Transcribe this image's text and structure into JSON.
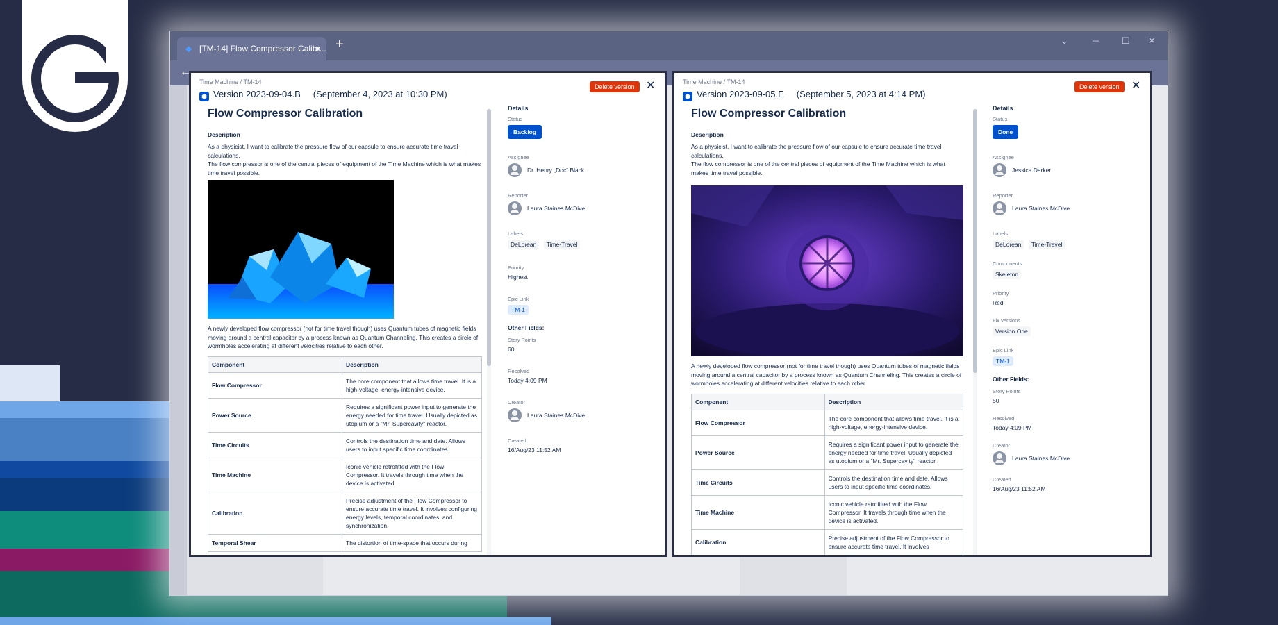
{
  "browser": {
    "tab_title": "[TM-14] Flow Compressor Calibr...",
    "tab_close": "×",
    "new_tab": "+",
    "win_min": "─",
    "win_max": "☐",
    "win_close": "✕",
    "back": "←"
  },
  "left": {
    "breadcrumb": "Time Machine  /  TM-14",
    "version": "Version 2023-09-04.B",
    "version_date": "(September 4, 2023 at 10:30 PM)",
    "delete_label": "Delete version",
    "close": "✕",
    "title": "Flow Compressor Calibration",
    "desc_heading": "Description",
    "desc_p1": "As a physicist, I want to calibrate the pressure flow of our capsule to ensure accurate time travel calculations.",
    "desc_p2": "The flow compressor is one of the central pieces of equipment of the Time Machine which is what makes time travel possible.",
    "desc_p3": "A newly developed flow compressor (not for time travel though) uses Quantum tubes of magnetic fields moving around a central capacitor by a process known as Quantum Channeling. This creates a circle of wormholes accelerating at different velocities relative to each other.",
    "table_head": [
      "Component",
      "Description"
    ],
    "rows": [
      [
        "Flow Compressor",
        "The core component that allows time travel. It is a high-voltage, energy-intensive device."
      ],
      [
        "Power Source",
        "Requires a significant power input to generate the energy needed for time travel. Usually depicted as utopium or a \"Mr. Supercavity\" reactor."
      ],
      [
        "Time Circuits",
        "Controls the destination time and date. Allows users to input specific time coordinates."
      ],
      [
        "Time Machine",
        "Iconic vehicle retrofitted with the Flow Compressor. It travels through time when the device is activated."
      ],
      [
        "Calibration",
        "Precise adjustment of the Flow Compressor to ensure accurate time travel. It involves configuring energy levels, temporal coordinates, and synchronization."
      ],
      [
        "Temporal Shear",
        "The distortion of time-space that occurs during"
      ]
    ],
    "details": {
      "heading": "Details",
      "status_label": "Status",
      "status": "Backlog",
      "assignee_label": "Assignee",
      "assignee": "Dr. Henry „Doc“ Black",
      "reporter_label": "Reporter",
      "reporter": "Laura Staines McDive",
      "labels_label": "Labels",
      "labels": [
        "DeLorean",
        "Time-Travel"
      ],
      "priority_label": "Priority",
      "priority": "Highest",
      "epic_label": "Epic Link",
      "epic": "TM-1",
      "other_heading": "Other Fields:",
      "story_points_label": "Story Points",
      "story_points": "60",
      "resolved_label": "Resolved",
      "resolved": "Today 4:09 PM",
      "creator_label": "Creator",
      "creator": "Laura Staines McDive",
      "created_label": "Created",
      "created": "16/Aug/23 11:52 AM"
    }
  },
  "right": {
    "breadcrumb": "Time Machine  /  TM-14",
    "version": "Version 2023-09-05.E",
    "version_date": "(September 5, 2023 at 4:14 PM)",
    "delete_label": "Delete version",
    "close": "✕",
    "title": "Flow Compressor Calibration",
    "desc_heading": "Description",
    "desc_p1": "As a physicist, I want to calibrate the pressure flow of our capsule to ensure accurate time travel calculations.",
    "desc_p2": "The flow compressor is one of the central pieces of equipment of the Time Machine which is what makes time travel possible.",
    "desc_p3": "A newly developed flow compressor (not for time travel though) uses Quantum tubes of magnetic fields moving around a central capacitor by a process known as Quantum Channeling. This creates a circle of wormholes accelerating at different velocities relative to each other.",
    "table_head": [
      "Component",
      "Description"
    ],
    "rows": [
      [
        "Flow Compressor",
        "The core component that allows time travel. It is a high-voltage, energy-intensive device."
      ],
      [
        "Power Source",
        "Requires a significant power input to generate the energy needed for time travel. Usually depicted as utopium or a \"Mr. Supercavity\" reactor."
      ],
      [
        "Time Circuits",
        "Controls the destination time and date. Allows users to input specific time coordinates."
      ],
      [
        "Time Machine",
        "Iconic vehicle retrofitted with the Flow Compressor. It travels through time when the device is activated."
      ],
      [
        "Calibration",
        "Precise adjustment of the Flow Compressor to ensure accurate time travel. It involves"
      ]
    ],
    "details": {
      "heading": "Details",
      "status_label": "Status",
      "status": "Done",
      "assignee_label": "Assignee",
      "assignee": "Jessica Darker",
      "reporter_label": "Reporter",
      "reporter": "Laura Staines McDive",
      "labels_label": "Labels",
      "labels": [
        "DeLorean",
        "Time-Travel"
      ],
      "components_label": "Components",
      "components": "Skeleton",
      "priority_label": "Priority",
      "priority": "Red",
      "fixver_label": "Fix versions",
      "fixver": "Version One",
      "epic_label": "Epic Link",
      "epic": "TM-1",
      "other_heading": "Other Fields:",
      "story_points_label": "Story Points",
      "story_points": "50",
      "resolved_label": "Resolved",
      "resolved": "Today 4:09 PM",
      "creator_label": "Creator",
      "creator": "Laura Staines McDive",
      "created_label": "Created",
      "created": "16/Aug/23 11:52 AM"
    }
  },
  "colors": {
    "status_blue": "#0052cc",
    "danger": "#de350b",
    "backdrop": "#262c45"
  },
  "icons": [
    "brand-logo-icon",
    "jira-favicon-icon",
    "version-icon",
    "close-icon",
    "avatar-icon"
  ]
}
